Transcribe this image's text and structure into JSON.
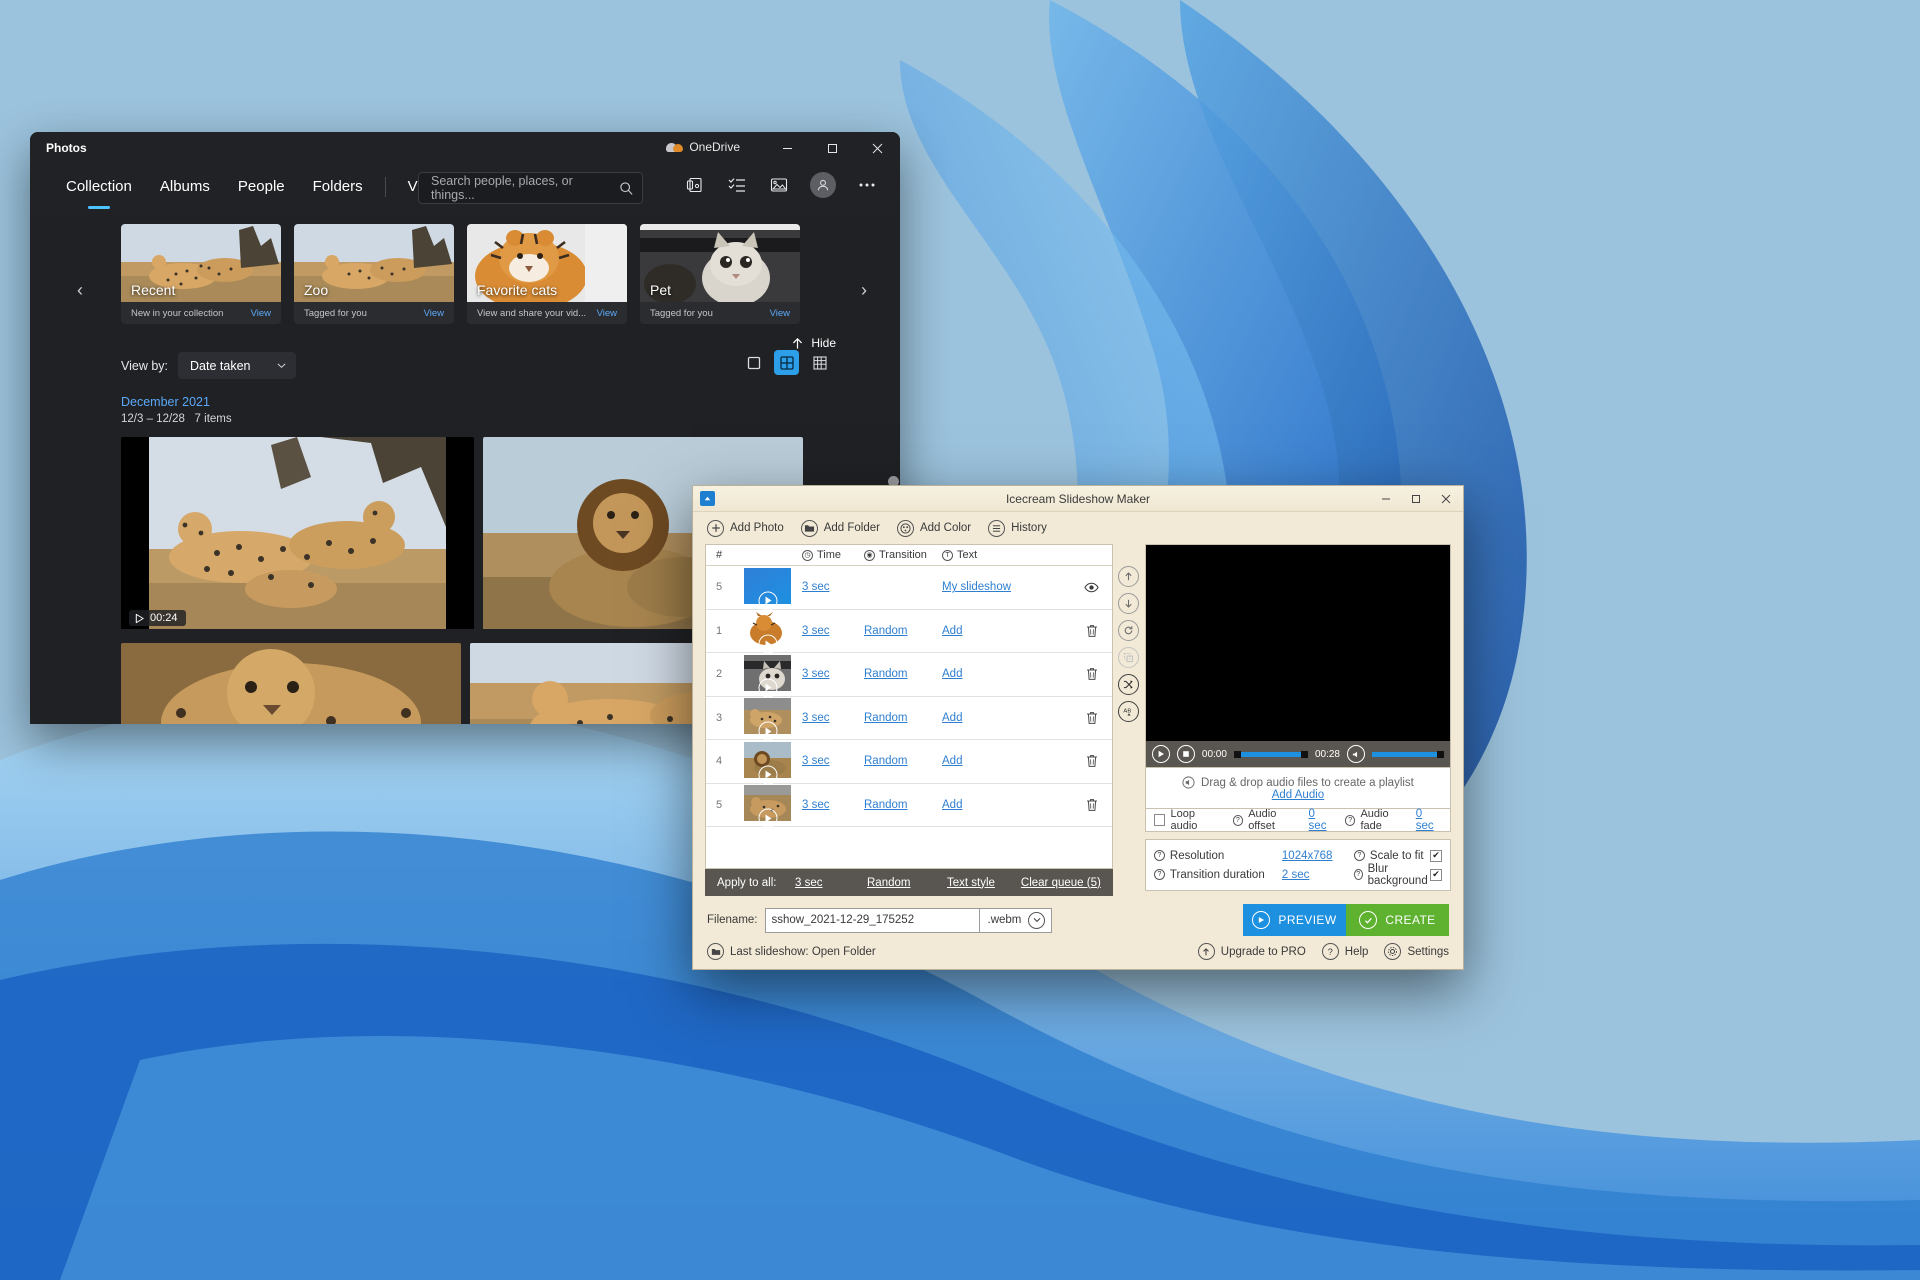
{
  "photos": {
    "window_title": "Photos",
    "onedrive_label": "OneDrive",
    "tabs": [
      {
        "label": "Collection",
        "active": true
      },
      {
        "label": "Albums",
        "active": false
      },
      {
        "label": "People",
        "active": false
      },
      {
        "label": "Folders",
        "active": false
      },
      {
        "label": "Video Editor",
        "active": false
      }
    ],
    "search": {
      "placeholder": "Search people, places, or things...",
      "value": ""
    },
    "titlebar_icons": [
      "minimize-icon",
      "maximize-icon",
      "close-icon"
    ],
    "toolbar_icons": [
      "import-icon",
      "select-icon",
      "create-video-icon",
      "account-icon",
      "more-icon"
    ],
    "cards": [
      {
        "name": "Recent",
        "subtitle": "New in your collection",
        "action": "View"
      },
      {
        "name": "Zoo",
        "subtitle": "Tagged for you",
        "action": "View"
      },
      {
        "name": "Favorite cats",
        "subtitle": "View and share your vid...",
        "action": "View"
      },
      {
        "name": "Pet",
        "subtitle": "Tagged for you",
        "action": "View"
      }
    ],
    "hide_label": "Hide",
    "view_by_label": "View by:",
    "view_by_value": "Date taken",
    "view_modes": [
      "single-view",
      "grid-view",
      "dense-grid-view"
    ],
    "active_view_mode": 1,
    "month_header": "December 2021",
    "month_range": "12/3 – 12/28",
    "item_count": "7 items",
    "video_duration": "00:24"
  },
  "ice": {
    "window_title": "Icecream Slideshow Maker",
    "toolbar": [
      {
        "label": "Add Photo",
        "icon": "plus-icon"
      },
      {
        "label": "Add Folder",
        "icon": "folder-icon"
      },
      {
        "label": "Add Color",
        "icon": "palette-icon"
      },
      {
        "label": "History",
        "icon": "list-icon"
      }
    ],
    "columns": {
      "hash": "#",
      "time": "Time",
      "transition": "Transition",
      "text": "Text"
    },
    "rows": [
      {
        "num": "5",
        "time": "3 sec",
        "transition": "",
        "text": "My slideshow",
        "action": "eye-icon",
        "selected": true
      },
      {
        "num": "1",
        "time": "3 sec",
        "transition": "Random",
        "text": "Add",
        "action": "trash-icon",
        "selected": false
      },
      {
        "num": "2",
        "time": "3 sec",
        "transition": "Random",
        "text": "Add",
        "action": "trash-icon",
        "selected": false
      },
      {
        "num": "3",
        "time": "3 sec",
        "transition": "Random",
        "text": "Add",
        "action": "trash-icon",
        "selected": false
      },
      {
        "num": "4",
        "time": "3 sec",
        "transition": "Random",
        "text": "Add",
        "action": "trash-icon",
        "selected": false
      },
      {
        "num": "5",
        "time": "3 sec",
        "transition": "Random",
        "text": "Add",
        "action": "trash-icon",
        "selected": false
      }
    ],
    "apply_to_all": {
      "label": "Apply to all:",
      "time": "3 sec",
      "transition": "Random",
      "text_style": "Text style",
      "clear_queue": "Clear queue (5)"
    },
    "side_tools": [
      "move-up-icon",
      "move-down-icon",
      "rotate-icon",
      "duplicate-icon",
      "shuffle-icon",
      "sort-ab-icon"
    ],
    "player": {
      "current_time": "00:00",
      "total_time": "00:28"
    },
    "audio": {
      "drop_hint": "Drag & drop audio files to create a playlist",
      "add_audio": "Add Audio",
      "loop_label": "Loop audio",
      "loop_checked": false,
      "offset_label": "Audio offset",
      "offset_value": "0 sec",
      "fade_label": "Audio fade",
      "fade_value": "0 sec"
    },
    "settings": {
      "resolution_label": "Resolution",
      "resolution_value": "1024x768",
      "transition_label": "Transition duration",
      "transition_value": "2 sec",
      "scale_label": "Scale to fit",
      "scale_checked": true,
      "blur_label": "Blur background",
      "blur_checked": true
    },
    "filename": {
      "label": "Filename:",
      "value": "sshow_2021-12-29_175252",
      "extension": ".webm"
    },
    "buttons": {
      "preview": "PREVIEW",
      "create": "CREATE"
    },
    "footer": {
      "last_slideshow": "Last slideshow: Open Folder",
      "upgrade": "Upgrade to PRO",
      "help": "Help",
      "settings": "Settings"
    }
  },
  "colors": {
    "accent_blue": "#4cc2ff",
    "link_blue": "#2f7fd0",
    "preview_blue": "#1e90e0",
    "create_green": "#5eb230",
    "ice_bg": "#f2ead7",
    "photos_bg": "#202124"
  }
}
